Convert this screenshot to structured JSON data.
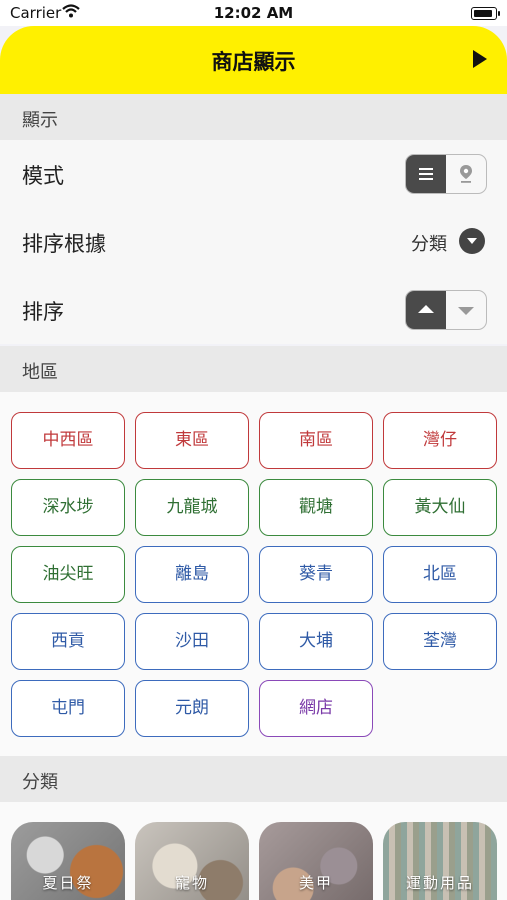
{
  "status_bar": {
    "carrier": "Carrier",
    "time": "12:02 AM"
  },
  "header": {
    "title": "商店顯示"
  },
  "display_section": {
    "title": "顯示",
    "mode_label": "模式",
    "sort_by_label": "排序根據",
    "sort_by_value": "分類",
    "order_label": "排序"
  },
  "area_section": {
    "title": "地區",
    "areas": [
      {
        "label": "中西區",
        "color": "#c0393b"
      },
      {
        "label": "東區",
        "color": "#c0393b"
      },
      {
        "label": "南區",
        "color": "#c0393b"
      },
      {
        "label": "灣仔",
        "color": "#c0393b"
      },
      {
        "label": "深水埗",
        "color": "#3b8a3e"
      },
      {
        "label": "九龍城",
        "color": "#3b8a3e"
      },
      {
        "label": "觀塘",
        "color": "#3b8a3e"
      },
      {
        "label": "黃大仙",
        "color": "#3b8a3e"
      },
      {
        "label": "油尖旺",
        "color": "#3b8a3e"
      },
      {
        "label": "離島",
        "color": "#3d6bbd"
      },
      {
        "label": "葵青",
        "color": "#3d6bbd"
      },
      {
        "label": "北區",
        "color": "#3d6bbd"
      },
      {
        "label": "西貢",
        "color": "#3d6bbd"
      },
      {
        "label": "沙田",
        "color": "#3d6bbd"
      },
      {
        "label": "大埔",
        "color": "#3d6bbd"
      },
      {
        "label": "荃灣",
        "color": "#3d6bbd"
      },
      {
        "label": "屯門",
        "color": "#3d6bbd"
      },
      {
        "label": "元朗",
        "color": "#3d6bbd"
      },
      {
        "label": "網店",
        "color": "#8a49b8"
      }
    ]
  },
  "category_section": {
    "title": "分類",
    "categories": [
      "夏日祭",
      "寵物",
      "美甲",
      "運動用品"
    ]
  },
  "colors": {
    "header": "#fff000",
    "toggle_active": "#4a4a4a"
  }
}
